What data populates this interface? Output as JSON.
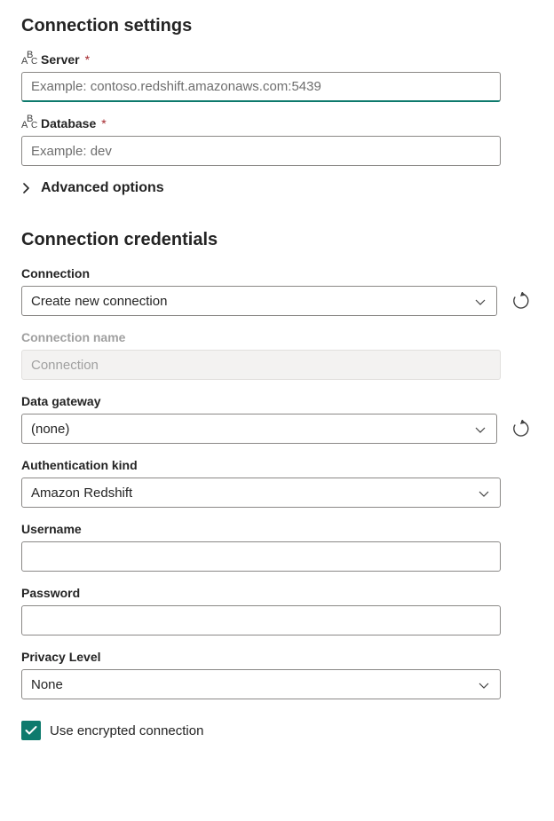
{
  "settings": {
    "heading": "Connection settings",
    "server": {
      "label": "Server",
      "placeholder": "Example: contoso.redshift.amazonaws.com:5439",
      "value": ""
    },
    "database": {
      "label": "Database",
      "placeholder": "Example: dev",
      "value": ""
    },
    "advanced": "Advanced options"
  },
  "credentials": {
    "heading": "Connection credentials",
    "connection": {
      "label": "Connection",
      "value": "Create new connection"
    },
    "connection_name": {
      "label": "Connection name",
      "value": "Connection"
    },
    "gateway": {
      "label": "Data gateway",
      "value": "(none)"
    },
    "auth_kind": {
      "label": "Authentication kind",
      "value": "Amazon Redshift"
    },
    "username": {
      "label": "Username",
      "value": ""
    },
    "password": {
      "label": "Password",
      "value": ""
    },
    "privacy": {
      "label": "Privacy Level",
      "value": "None"
    },
    "encrypted": {
      "label": "Use encrypted connection",
      "checked": true
    }
  }
}
